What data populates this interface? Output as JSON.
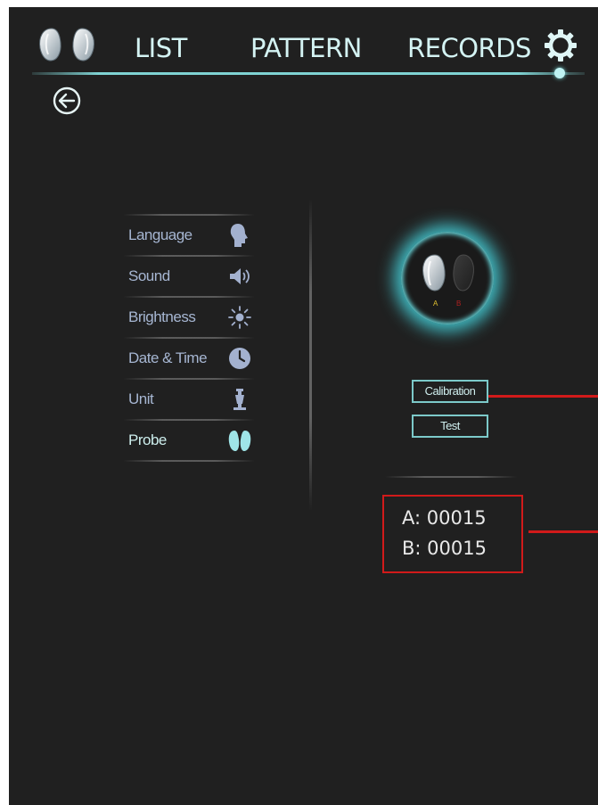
{
  "nav": {
    "tabs": [
      {
        "label": "LIST"
      },
      {
        "label": "PATTERN"
      },
      {
        "label": "RECORDS"
      }
    ]
  },
  "settings_menu": {
    "items": [
      {
        "label": "Language",
        "icon": "head-icon"
      },
      {
        "label": "Sound",
        "icon": "speaker-icon"
      },
      {
        "label": "Brightness",
        "icon": "sun-icon"
      },
      {
        "label": "Date & Time",
        "icon": "clock-icon"
      },
      {
        "label": "Unit",
        "icon": "unit-icon"
      },
      {
        "label": "Probe",
        "icon": "probe-icon",
        "active": true
      }
    ]
  },
  "probe_panel": {
    "probe_a_label": "A",
    "probe_b_label": "B",
    "calibration_label": "Calibration",
    "test_label": "Test",
    "counter_a": "A: 00015",
    "counter_b": "B: 00015"
  },
  "colors": {
    "background": "#202020",
    "accent": "#7fd3d3",
    "highlight": "#d11a1a",
    "menu_text": "#a6b6d2"
  }
}
